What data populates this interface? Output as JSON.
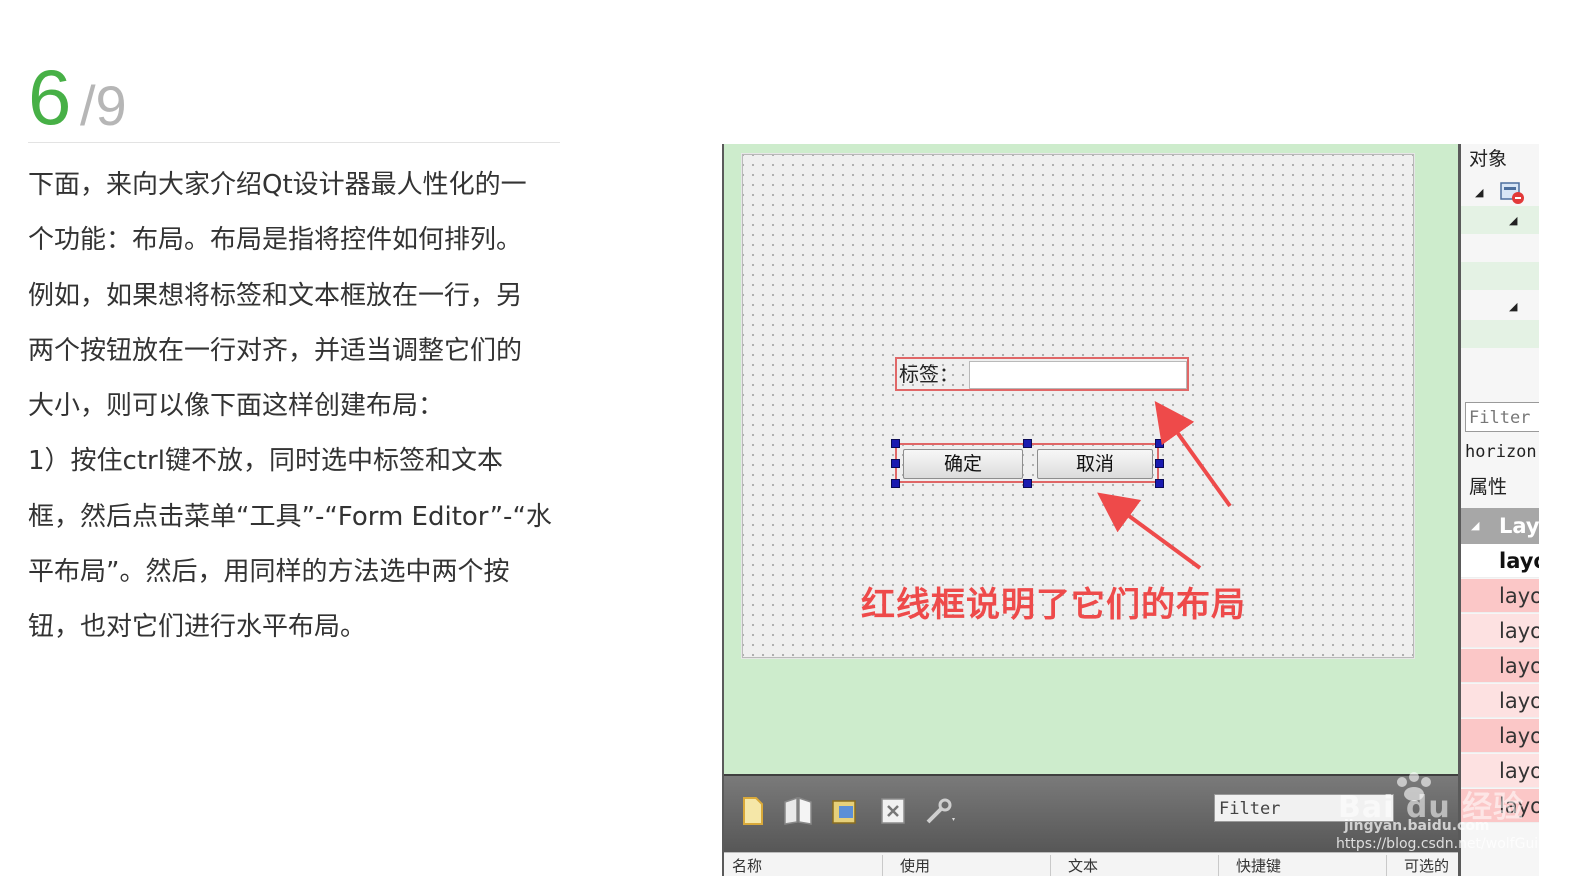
{
  "step": {
    "current": "6",
    "total": "/9"
  },
  "article": {
    "lines": [
      "下面，来向大家介绍Qt设计器最人性化的一",
      "个功能：布局。布局是指将控件如何排列。",
      "例如，如果想将标签和文本框放在一行，另",
      "两个按钮放在一行对齐，并适当调整它们的",
      "大小，则可以像下面这样创建布局：",
      "1）按住ctrl键不放，同时选中标签和文本",
      "框，然后点击菜单“工具”-“Form Editor”-“水",
      "平布局”。然后，用同样的方法选中两个按",
      "钮，也对它们进行水平布局。"
    ]
  },
  "form": {
    "label_text": "标签：",
    "ok_button": "确定",
    "cancel_button": "取消",
    "annotation": "红线框说明了它们的布局"
  },
  "bottom_panel": {
    "filter": "Filter",
    "columns": [
      "名称",
      "使用",
      "文本",
      "快捷键",
      "可选的"
    ]
  },
  "object_panel": {
    "title": "对象",
    "filter": "Filter",
    "current_object": "horizon",
    "property_title": "属性",
    "group_name": "Lay",
    "properties": [
      "layo",
      "layo",
      "layo",
      "layo",
      "layo",
      "layo",
      "layo",
      "layo"
    ]
  },
  "watermark": {
    "brand": "Bai du 经验",
    "site": "jingyan.baidu.com",
    "url": "https://blog.csdn.net/wolfGuiDao"
  },
  "colors": {
    "step_green": "#47b046",
    "canvas_green": "#cdeccc",
    "layout_red": "#e06767",
    "annotation_red": "#ee4a4a"
  }
}
